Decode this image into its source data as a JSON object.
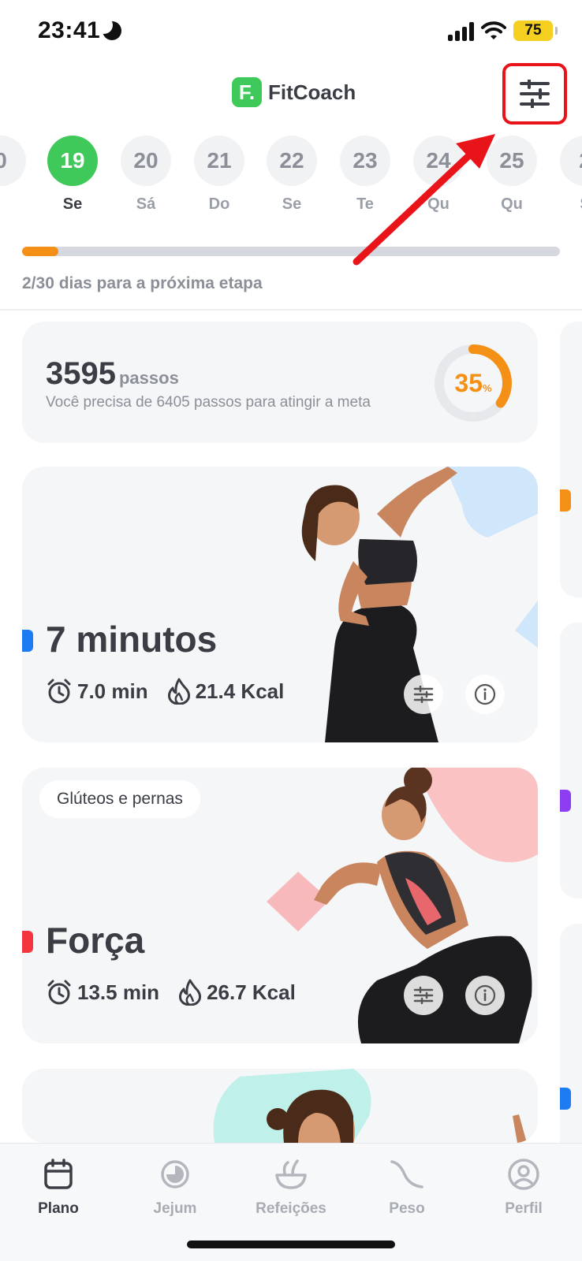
{
  "status_bar": {
    "time": "23:41",
    "battery": "75"
  },
  "header": {
    "app_name": "FitCoach",
    "logo_letter": "F."
  },
  "date_strip": {
    "days": [
      {
        "num": "0",
        "dow": ""
      },
      {
        "num": "19",
        "dow": "Se",
        "active": true
      },
      {
        "num": "20",
        "dow": "Sá"
      },
      {
        "num": "21",
        "dow": "Do"
      },
      {
        "num": "22",
        "dow": "Se"
      },
      {
        "num": "23",
        "dow": "Te"
      },
      {
        "num": "24",
        "dow": "Qu"
      },
      {
        "num": "25",
        "dow": "Qu"
      },
      {
        "num": "2",
        "dow": "S"
      }
    ]
  },
  "progress": {
    "text": "2/30 dias para a próxima etapa",
    "fraction": 0.067
  },
  "steps_card": {
    "value": "3595",
    "unit": "passos",
    "note": "Você precisa de 6405 passos para atingir a meta",
    "percent": "35",
    "percent_sign": "%",
    "fraction": 0.35
  },
  "workouts": [
    {
      "title": "7 minutos",
      "duration": "7.0 min",
      "calories": "21.4 Kcal",
      "accent": "#1e7cf2"
    },
    {
      "chip": "Glúteos e pernas",
      "title": "Força",
      "duration": "13.5 min",
      "calories": "26.7 Kcal",
      "accent": "#f2353e"
    }
  ],
  "side_accents": [
    "#f39015",
    "#8e3ef2",
    "#1e7cf2"
  ],
  "tabs": [
    {
      "label": "Plano",
      "icon": "calendar-icon",
      "active": true
    },
    {
      "label": "Jejum",
      "icon": "fasting-icon"
    },
    {
      "label": "Refeições",
      "icon": "meal-bowl-icon"
    },
    {
      "label": "Peso",
      "icon": "weight-curve-icon"
    },
    {
      "label": "Perfil",
      "icon": "profile-icon"
    }
  ],
  "colors": {
    "brand_green": "#3ec95a",
    "accent_orange": "#f39015",
    "annotation_red": "#e8141a"
  }
}
